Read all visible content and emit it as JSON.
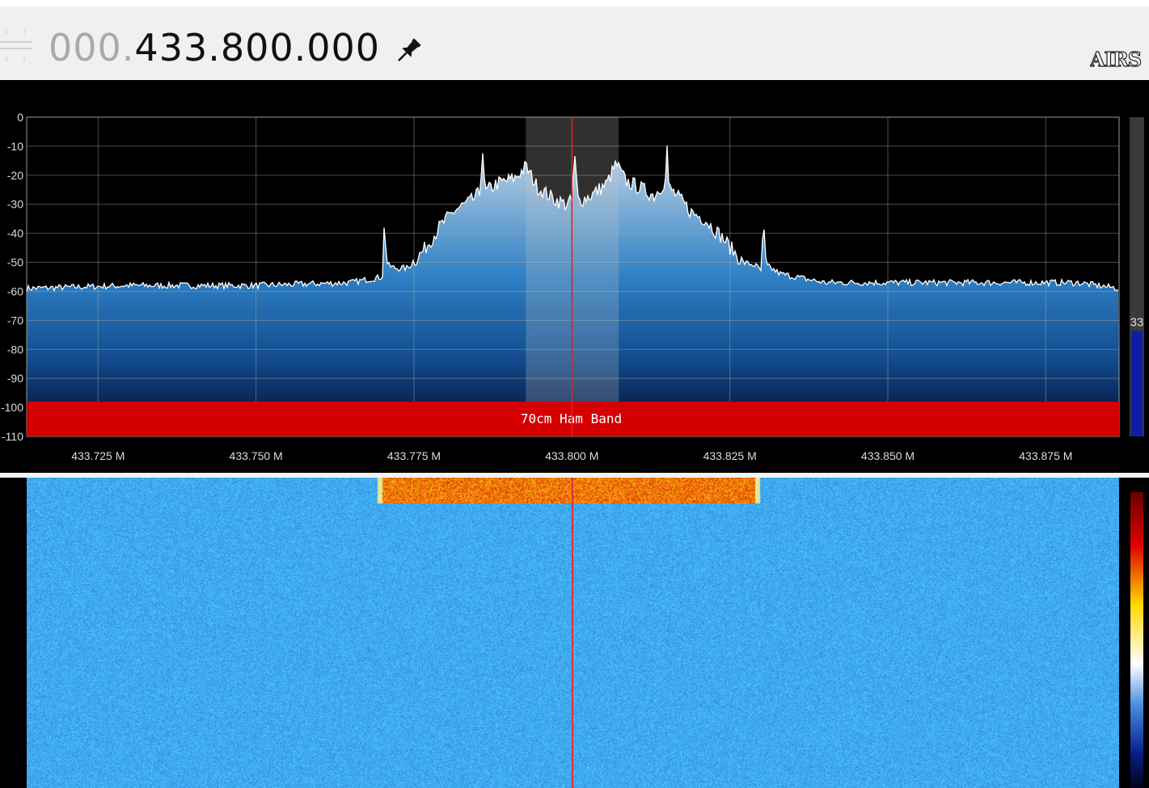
{
  "header": {
    "frequency_dim": "000.",
    "frequency_lit": "433.800.000",
    "pin_icon": "pin-icon",
    "logo_text": "AIRS"
  },
  "chart_data": {
    "type": "area",
    "title": "",
    "xlabel": "",
    "ylabel": "",
    "x_ticks": [
      "433.725 M",
      "433.750 M",
      "433.775 M",
      "433.800 M",
      "433.825 M",
      "433.850 M",
      "433.875 M"
    ],
    "x_tick_values": [
      433.725,
      433.75,
      433.775,
      433.8,
      433.825,
      433.85,
      433.875
    ],
    "y_ticks": [
      "0",
      "-10",
      "-20",
      "-30",
      "-40",
      "-50",
      "-60",
      "-70",
      "-80",
      "-90",
      "-100",
      "-110"
    ],
    "xlim": [
      433.7137,
      433.8866
    ],
    "ylim": [
      -110,
      0
    ],
    "grid": true,
    "center_frequency": 433.8,
    "filter_band": [
      433.7927,
      433.8074
    ],
    "band_label": "70cm Ham Band",
    "band_level": [
      -98,
      -110
    ],
    "series": [
      {
        "values_x": [
          433.7137,
          433.73,
          433.75,
          433.765,
          433.77,
          433.7703,
          433.7708,
          433.772,
          433.774,
          433.7765,
          433.779,
          433.7815,
          433.784,
          433.7855,
          433.7858,
          433.7862,
          433.788,
          433.791,
          433.7927,
          433.7945,
          433.797,
          433.799,
          433.8,
          433.8004,
          433.801,
          433.803,
          433.8055,
          433.807,
          433.8085,
          433.8105,
          433.813,
          433.8148,
          433.815,
          433.8153,
          433.817,
          433.819,
          433.821,
          433.824,
          433.827,
          433.829,
          433.83,
          433.8303,
          433.8307,
          433.833,
          433.84,
          433.86,
          433.88,
          433.8866
        ],
        "values_y": [
          -59,
          -58,
          -58,
          -57,
          -55,
          -37,
          -51,
          -52,
          -52,
          -46,
          -38,
          -32,
          -29,
          -26,
          -8,
          -26,
          -23,
          -21,
          -17,
          -24,
          -28,
          -30,
          -29,
          -13,
          -29,
          -27,
          -23,
          -16,
          -22,
          -24,
          -27,
          -22,
          -6,
          -24,
          -28,
          -33,
          -35,
          -42,
          -50,
          -51,
          -53,
          -36,
          -51,
          -54,
          -57,
          -57,
          -57,
          -59
        ]
      }
    ],
    "level_meter": {
      "value": 33,
      "label": "33"
    }
  }
}
